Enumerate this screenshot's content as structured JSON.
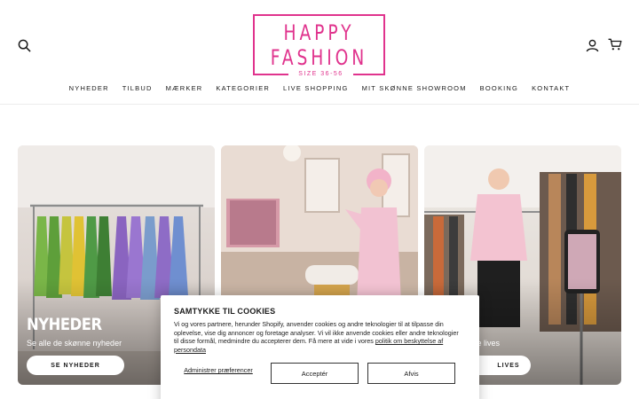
{
  "header": {
    "logo": {
      "line1": "HAPPY",
      "line2": "FASHION",
      "tagline": "SIZE 36-56",
      "color": "#e0338d"
    },
    "icons": [
      "search-icon",
      "account-icon",
      "cart-icon"
    ]
  },
  "nav": {
    "items": [
      {
        "label": "NYHEDER"
      },
      {
        "label": "TILBUD"
      },
      {
        "label": "MÆRKER"
      },
      {
        "label": "KATEGORIER"
      },
      {
        "label": "LIVE SHOPPING"
      },
      {
        "label": "MIT SKØNNE SHOWROOM"
      },
      {
        "label": "BOOKING"
      },
      {
        "label": "KONTAKT"
      }
    ]
  },
  "cards": [
    {
      "title": "NYHEDER",
      "subtitle": "Se alle de skønne nyheder",
      "button": "SE NYHEDER"
    },
    {
      "title": "",
      "subtitle": "",
      "button": ""
    },
    {
      "subtitle_visible": "se lives",
      "button_visible": "LIVES"
    }
  ],
  "consent": {
    "title": "SAMTYKKE TIL COOKIES",
    "text": "Vi og vores partnere, herunder Shopify, anvender cookies og andre teknologier til at tilpasse din oplevelse, vise dig annoncer og foretage analyser. Vi vil ikke anvende cookies eller andre teknologier til disse formål, medmindre du accepterer dem. Få mere at vide i vores ",
    "policy_link": "politik om beskyttelse af persondata",
    "manage": "Administrer præferencer",
    "accept": "Acceptér",
    "decline": "Afvis"
  }
}
